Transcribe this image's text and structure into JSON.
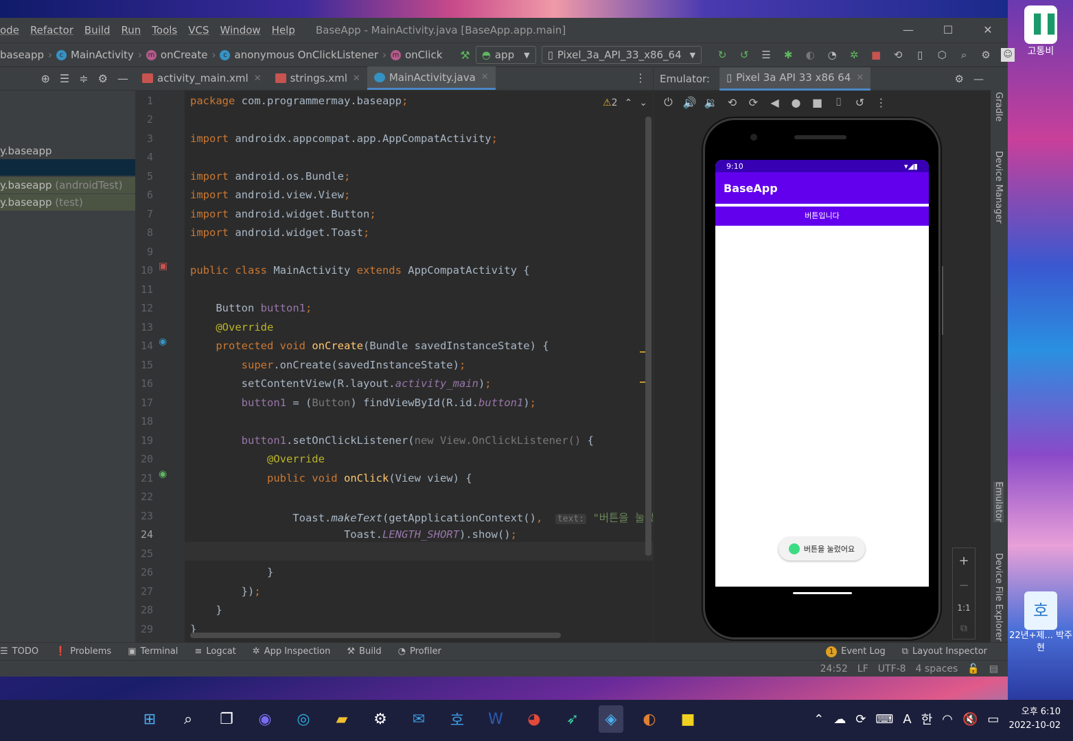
{
  "window": {
    "menu": [
      "ode",
      "Refactor",
      "Build",
      "Run",
      "Tools",
      "VCS",
      "Window",
      "Help"
    ],
    "title": "BaseApp - MainActivity.java [BaseApp.app.main]",
    "controls": [
      "—",
      "☐",
      "✕"
    ]
  },
  "breadcrumbs": [
    "baseapp",
    "MainActivity",
    "onCreate",
    "anonymous OnClickListener",
    "onClick"
  ],
  "run_config": "app",
  "device_config": "Pixel_3a_API_33_x86_64",
  "project_tree": [
    {
      "label": "y.baseapp",
      "tag": ""
    },
    {
      "label": "y.baseapp",
      "tag": "(androidTest)"
    },
    {
      "label": "y.baseapp",
      "tag": "(test)"
    }
  ],
  "editor_tabs": [
    {
      "label": "activity_main.xml",
      "type": "xml"
    },
    {
      "label": "strings.xml",
      "type": "xml"
    },
    {
      "label": "MainActivity.java",
      "type": "java"
    }
  ],
  "warning_count": "2",
  "line_numbers": [
    "1",
    "2",
    "3",
    "4",
    "5",
    "6",
    "7",
    "8",
    "9",
    "10",
    "11",
    "12",
    "13",
    "14",
    "15",
    "16",
    "17",
    "18",
    "19",
    "20",
    "21",
    "22",
    "23",
    "24",
    "25",
    "26",
    "27",
    "28",
    "29"
  ],
  "emulator": {
    "label": "Emulator:",
    "device_tab": "Pixel 3a API 33 x86 64",
    "status_time": "9:10",
    "app_title": "BaseApp",
    "button_text": "버튼입니다",
    "toast_text": "버튼을 눌렀어요",
    "zoom": [
      "+",
      "−",
      "1:1",
      "⧉"
    ]
  },
  "side_tools": [
    "Gradle",
    "Device Manager",
    "Emulator",
    "Device File Explorer"
  ],
  "bottom_tools": [
    "TODO",
    "Problems",
    "Terminal",
    "Logcat",
    "App Inspection",
    "Build",
    "Profiler"
  ],
  "bottom_right_tools": [
    "Event Log",
    "Layout Inspector"
  ],
  "event_log_count": "1",
  "status": {
    "position": "24:52",
    "line_sep": "LF",
    "encoding": "UTF-8",
    "indent": "4 spaces"
  },
  "desktop_icons": [
    "고통비",
    "22년+제... 박주현"
  ],
  "taskbar": {
    "time": "오후 6:10",
    "date": "2022-10-02",
    "ime": "A",
    "lang": "한"
  }
}
